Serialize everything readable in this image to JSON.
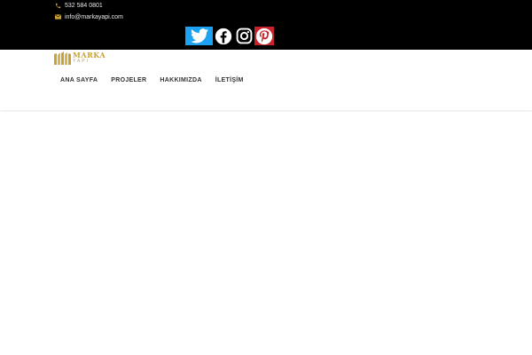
{
  "contact": {
    "phone": "532 584 0801",
    "email": "info@markayapi.com"
  },
  "social": [
    {
      "name": "twitter",
      "color": "#1da1f2"
    },
    {
      "name": "facebook",
      "color": "#000000"
    },
    {
      "name": "instagram",
      "color": "#000000"
    },
    {
      "name": "pinterest",
      "color": "#c8232c"
    }
  ],
  "logo": {
    "name": "MARKA",
    "sub": "YAPI"
  },
  "nav": {
    "items": [
      {
        "label": "ANA SAYFA"
      },
      {
        "label": "PROJELER"
      },
      {
        "label": "HAKKIMIZDA"
      },
      {
        "label": "İLETİŞİM"
      }
    ]
  },
  "colors": {
    "topbar": "#000000",
    "accent_gold": "#c9a233",
    "nav_text": "#333333"
  }
}
